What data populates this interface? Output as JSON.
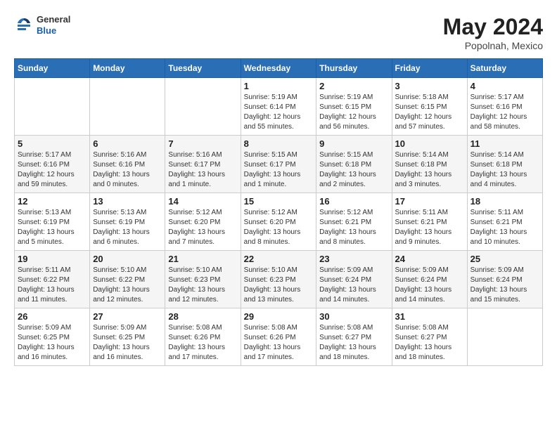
{
  "header": {
    "logo_general": "General",
    "logo_blue": "Blue",
    "month_year": "May 2024",
    "location": "Popolnah, Mexico"
  },
  "days_of_week": [
    "Sunday",
    "Monday",
    "Tuesday",
    "Wednesday",
    "Thursday",
    "Friday",
    "Saturday"
  ],
  "weeks": [
    [
      {
        "day": "",
        "content": ""
      },
      {
        "day": "",
        "content": ""
      },
      {
        "day": "",
        "content": ""
      },
      {
        "day": "1",
        "content": "Sunrise: 5:19 AM\nSunset: 6:14 PM\nDaylight: 12 hours\nand 55 minutes."
      },
      {
        "day": "2",
        "content": "Sunrise: 5:19 AM\nSunset: 6:15 PM\nDaylight: 12 hours\nand 56 minutes."
      },
      {
        "day": "3",
        "content": "Sunrise: 5:18 AM\nSunset: 6:15 PM\nDaylight: 12 hours\nand 57 minutes."
      },
      {
        "day": "4",
        "content": "Sunrise: 5:17 AM\nSunset: 6:16 PM\nDaylight: 12 hours\nand 58 minutes."
      }
    ],
    [
      {
        "day": "5",
        "content": "Sunrise: 5:17 AM\nSunset: 6:16 PM\nDaylight: 12 hours\nand 59 minutes."
      },
      {
        "day": "6",
        "content": "Sunrise: 5:16 AM\nSunset: 6:16 PM\nDaylight: 13 hours\nand 0 minutes."
      },
      {
        "day": "7",
        "content": "Sunrise: 5:16 AM\nSunset: 6:17 PM\nDaylight: 13 hours\nand 1 minute."
      },
      {
        "day": "8",
        "content": "Sunrise: 5:15 AM\nSunset: 6:17 PM\nDaylight: 13 hours\nand 1 minute."
      },
      {
        "day": "9",
        "content": "Sunrise: 5:15 AM\nSunset: 6:18 PM\nDaylight: 13 hours\nand 2 minutes."
      },
      {
        "day": "10",
        "content": "Sunrise: 5:14 AM\nSunset: 6:18 PM\nDaylight: 13 hours\nand 3 minutes."
      },
      {
        "day": "11",
        "content": "Sunrise: 5:14 AM\nSunset: 6:18 PM\nDaylight: 13 hours\nand 4 minutes."
      }
    ],
    [
      {
        "day": "12",
        "content": "Sunrise: 5:13 AM\nSunset: 6:19 PM\nDaylight: 13 hours\nand 5 minutes."
      },
      {
        "day": "13",
        "content": "Sunrise: 5:13 AM\nSunset: 6:19 PM\nDaylight: 13 hours\nand 6 minutes."
      },
      {
        "day": "14",
        "content": "Sunrise: 5:12 AM\nSunset: 6:20 PM\nDaylight: 13 hours\nand 7 minutes."
      },
      {
        "day": "15",
        "content": "Sunrise: 5:12 AM\nSunset: 6:20 PM\nDaylight: 13 hours\nand 8 minutes."
      },
      {
        "day": "16",
        "content": "Sunrise: 5:12 AM\nSunset: 6:21 PM\nDaylight: 13 hours\nand 8 minutes."
      },
      {
        "day": "17",
        "content": "Sunrise: 5:11 AM\nSunset: 6:21 PM\nDaylight: 13 hours\nand 9 minutes."
      },
      {
        "day": "18",
        "content": "Sunrise: 5:11 AM\nSunset: 6:21 PM\nDaylight: 13 hours\nand 10 minutes."
      }
    ],
    [
      {
        "day": "19",
        "content": "Sunrise: 5:11 AM\nSunset: 6:22 PM\nDaylight: 13 hours\nand 11 minutes."
      },
      {
        "day": "20",
        "content": "Sunrise: 5:10 AM\nSunset: 6:22 PM\nDaylight: 13 hours\nand 12 minutes."
      },
      {
        "day": "21",
        "content": "Sunrise: 5:10 AM\nSunset: 6:23 PM\nDaylight: 13 hours\nand 12 minutes."
      },
      {
        "day": "22",
        "content": "Sunrise: 5:10 AM\nSunset: 6:23 PM\nDaylight: 13 hours\nand 13 minutes."
      },
      {
        "day": "23",
        "content": "Sunrise: 5:09 AM\nSunset: 6:24 PM\nDaylight: 13 hours\nand 14 minutes."
      },
      {
        "day": "24",
        "content": "Sunrise: 5:09 AM\nSunset: 6:24 PM\nDaylight: 13 hours\nand 14 minutes."
      },
      {
        "day": "25",
        "content": "Sunrise: 5:09 AM\nSunset: 6:24 PM\nDaylight: 13 hours\nand 15 minutes."
      }
    ],
    [
      {
        "day": "26",
        "content": "Sunrise: 5:09 AM\nSunset: 6:25 PM\nDaylight: 13 hours\nand 16 minutes."
      },
      {
        "day": "27",
        "content": "Sunrise: 5:09 AM\nSunset: 6:25 PM\nDaylight: 13 hours\nand 16 minutes."
      },
      {
        "day": "28",
        "content": "Sunrise: 5:08 AM\nSunset: 6:26 PM\nDaylight: 13 hours\nand 17 minutes."
      },
      {
        "day": "29",
        "content": "Sunrise: 5:08 AM\nSunset: 6:26 PM\nDaylight: 13 hours\nand 17 minutes."
      },
      {
        "day": "30",
        "content": "Sunrise: 5:08 AM\nSunset: 6:27 PM\nDaylight: 13 hours\nand 18 minutes."
      },
      {
        "day": "31",
        "content": "Sunrise: 5:08 AM\nSunset: 6:27 PM\nDaylight: 13 hours\nand 18 minutes."
      },
      {
        "day": "",
        "content": ""
      }
    ]
  ]
}
